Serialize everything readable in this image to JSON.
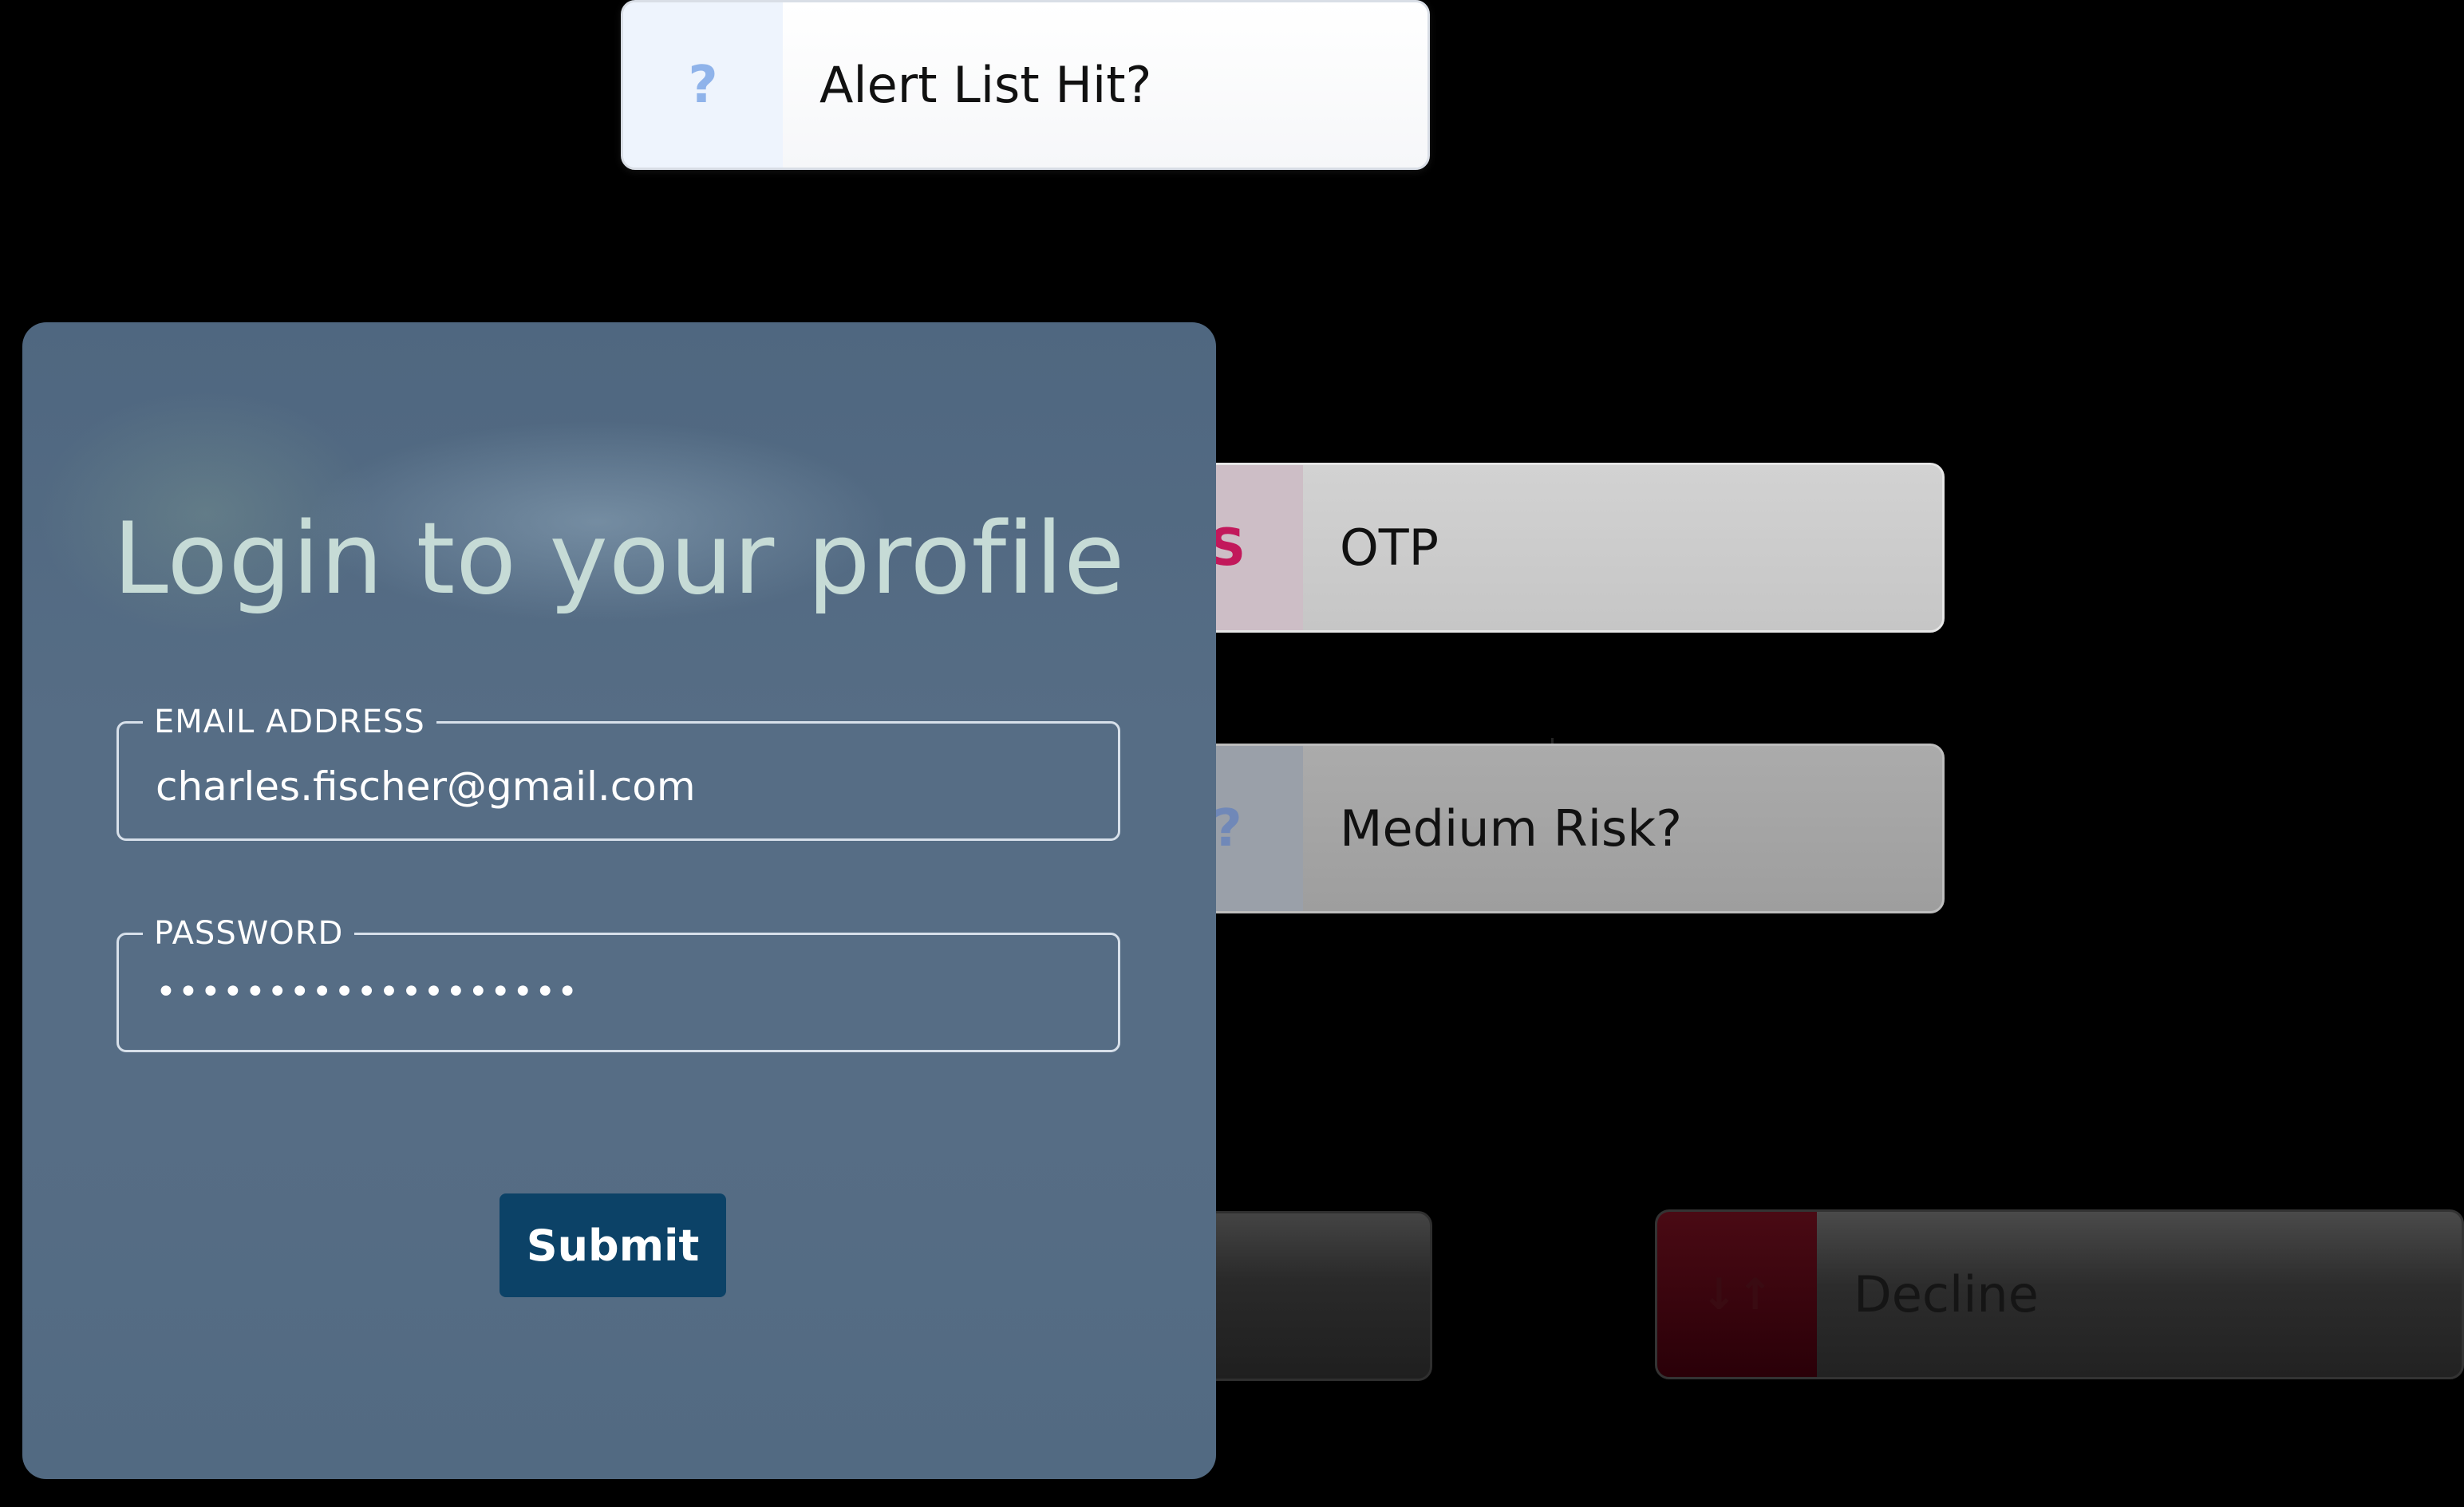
{
  "flow_nodes": {
    "alert_list_hit": {
      "icon": "?",
      "label": "Alert List Hit?"
    },
    "otp": {
      "icon": "S",
      "label": "OTP"
    },
    "medium_risk": {
      "icon": "?",
      "label": "Medium Risk?"
    },
    "decline": {
      "icon": "↓↑",
      "label": "Decline"
    }
  },
  "login": {
    "title": "Login to your profile",
    "email_label": "EMAIL ADDRESS",
    "email_value": "charles.fischer@gmail.com",
    "password_label": "PASSWORD",
    "password_value": "•••••••••••••••••••",
    "submit_label": "Submit"
  },
  "colors": {
    "background": "#000000",
    "card": "#566d85",
    "title_text": "#c6dbd6",
    "submit_button": "#0c4267",
    "otp_icon": "#c2185b",
    "decline_icon_bg": "#4a0a14"
  }
}
